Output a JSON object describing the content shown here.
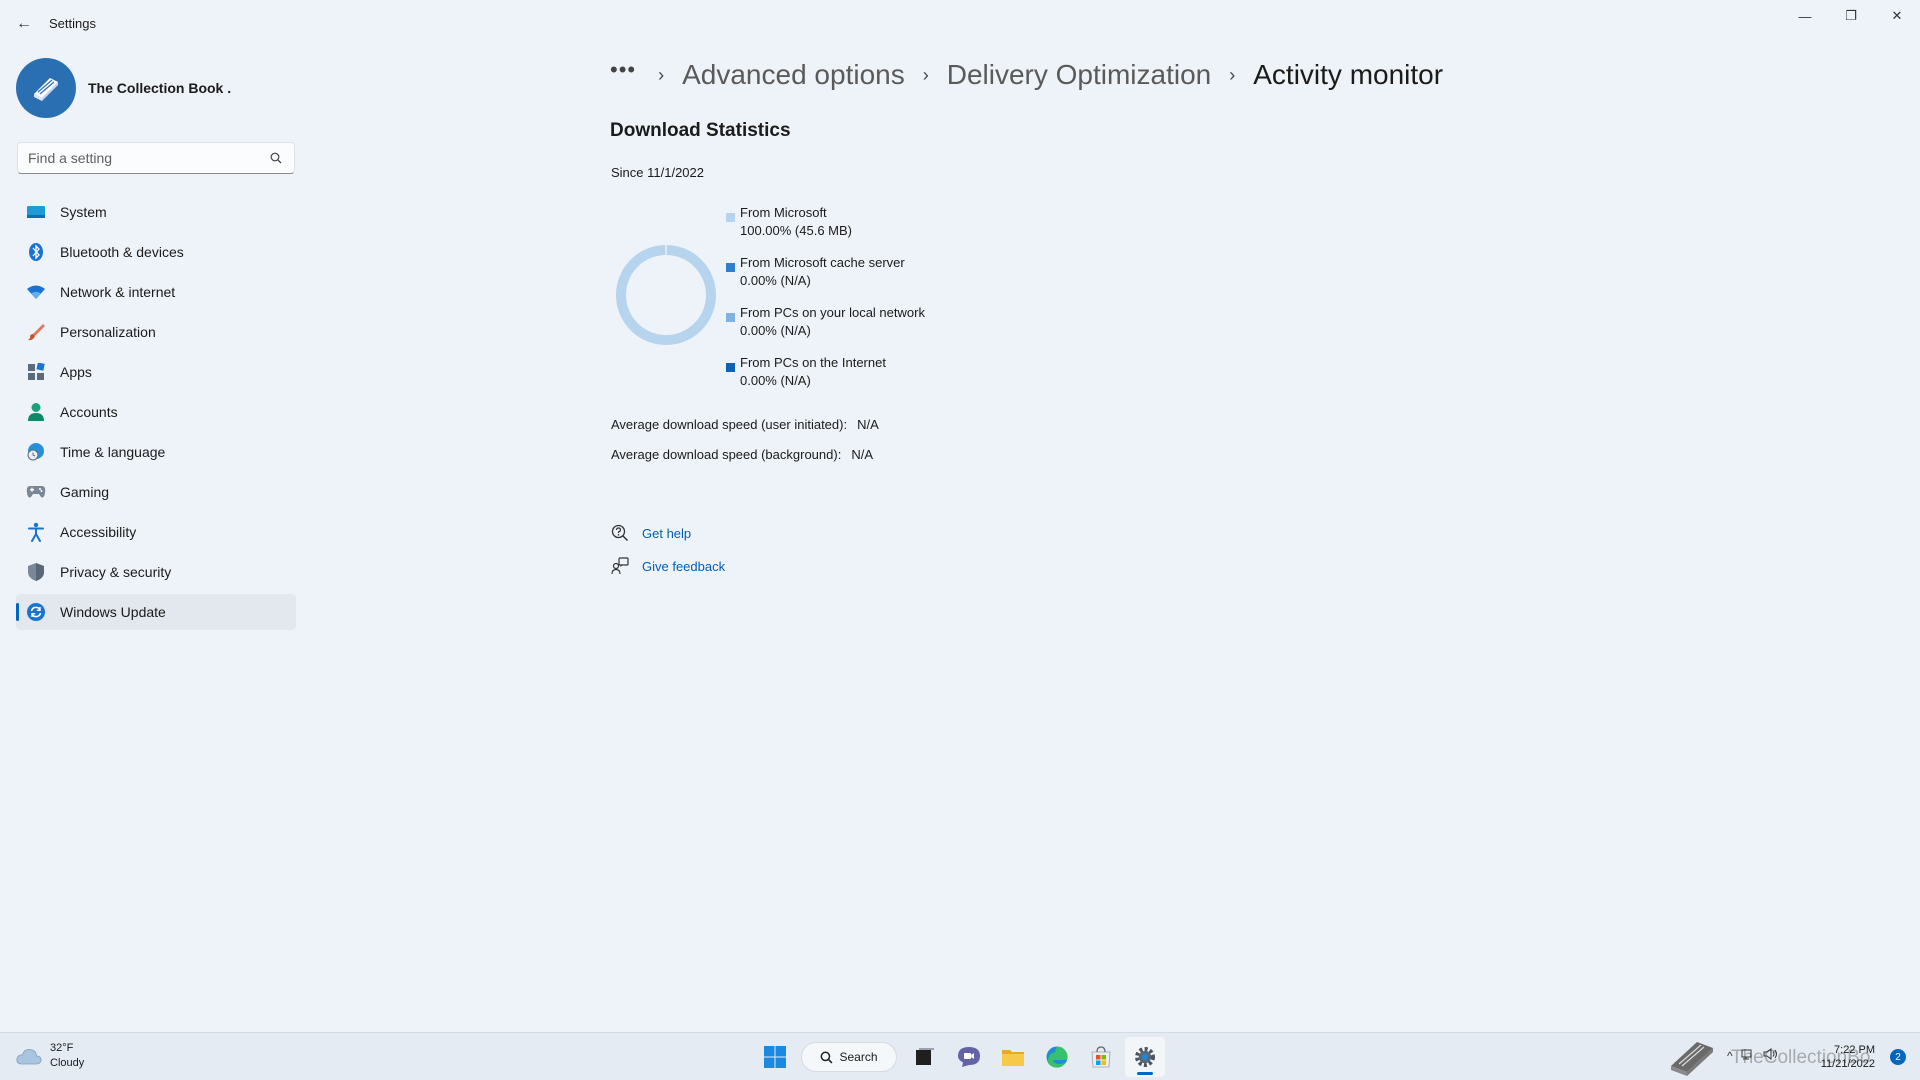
{
  "window": {
    "title": "Settings",
    "minimize_glyph": "—",
    "maximize_glyph": "❐",
    "close_glyph": "✕",
    "back_glyph": "←"
  },
  "profile": {
    "name": "The Collection Book ."
  },
  "search": {
    "placeholder": "Find a setting"
  },
  "sidebar": {
    "items": [
      {
        "label": "System",
        "icon": "monitor-icon"
      },
      {
        "label": "Bluetooth & devices",
        "icon": "bluetooth-icon"
      },
      {
        "label": "Network & internet",
        "icon": "wifi-icon"
      },
      {
        "label": "Personalization",
        "icon": "brush-icon"
      },
      {
        "label": "Apps",
        "icon": "apps-icon"
      },
      {
        "label": "Accounts",
        "icon": "person-icon"
      },
      {
        "label": "Time & language",
        "icon": "globe-clock-icon"
      },
      {
        "label": "Gaming",
        "icon": "controller-icon"
      },
      {
        "label": "Accessibility",
        "icon": "accessibility-icon"
      },
      {
        "label": "Privacy & security",
        "icon": "shield-icon"
      },
      {
        "label": "Windows Update",
        "icon": "update-icon",
        "active": true
      }
    ]
  },
  "breadcrumb": {
    "more": "•••",
    "sep": "›",
    "items": [
      "Advanced options",
      "Delivery Optimization",
      "Activity monitor"
    ]
  },
  "stats": {
    "title": "Download Statistics",
    "since": "Since 11/1/2022",
    "legend": [
      {
        "name": "From Microsoft",
        "value": "100.00%  (45.6 MB)",
        "color": "#b6d4ee",
        "percent": 100.0
      },
      {
        "name": "From Microsoft cache server",
        "value": "0.00%  (N/A)",
        "color": "#2f7fcf",
        "percent": 0.0
      },
      {
        "name": "From PCs on your local network",
        "value": "0.00%  (N/A)",
        "color": "#7fb2e0",
        "percent": 0.0
      },
      {
        "name": "From PCs on the Internet",
        "value": "0.00%  (N/A)",
        "color": "#0e62b4",
        "percent": 0.0
      }
    ],
    "avg_user_label": "Average download speed (user initiated):",
    "avg_user_value": "N/A",
    "avg_bg_label": "Average download speed (background):",
    "avg_bg_value": "N/A"
  },
  "links": {
    "help": "Get help",
    "feedback": "Give feedback"
  },
  "taskbar": {
    "weather_temp": "32°F",
    "weather_cond": "Cloudy",
    "search_label": "Search",
    "watermark": "TheCollectionBo",
    "time": "7:22 PM",
    "date": "11/21/2022",
    "notifications": "2"
  },
  "colors": {
    "accent": "#0067c0",
    "link": "#005fb8",
    "background": "#eef3f9"
  }
}
